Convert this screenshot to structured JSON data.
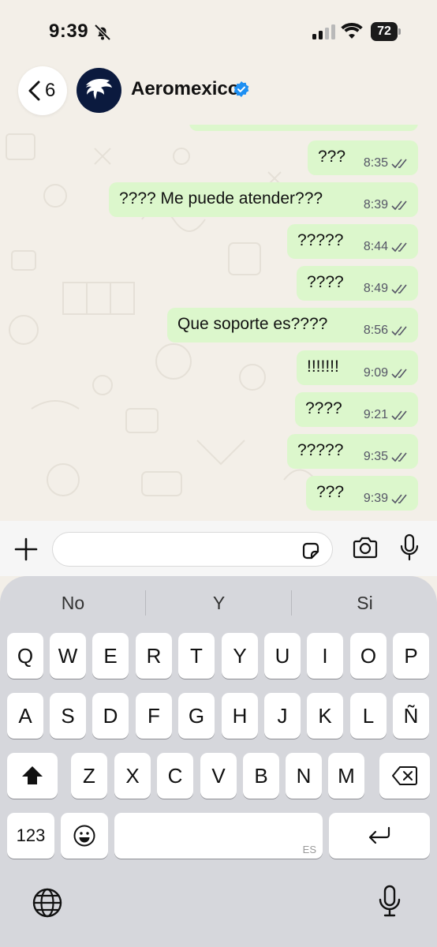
{
  "status_bar": {
    "time": "9:39",
    "battery": "72"
  },
  "header": {
    "back_count": "6",
    "contact_name": "Aeromexico"
  },
  "messages": [
    {
      "text": "???",
      "time": "8:35"
    },
    {
      "text": "???? Me puede atender???",
      "time": "8:39"
    },
    {
      "text": "?????",
      "time": "8:44"
    },
    {
      "text": "????",
      "time": "8:49"
    },
    {
      "text": "Que soporte es????",
      "time": "8:56"
    },
    {
      "text": "!!!!!!!",
      "time": "9:09"
    },
    {
      "text": "????",
      "time": "9:21"
    },
    {
      "text": "?????",
      "time": "9:35"
    },
    {
      "text": "???",
      "time": "9:39"
    }
  ],
  "input": {
    "placeholder": ""
  },
  "keyboard": {
    "suggestions": [
      "No",
      "Y",
      "Si"
    ],
    "row1": [
      "Q",
      "W",
      "E",
      "R",
      "T",
      "Y",
      "U",
      "I",
      "O",
      "P"
    ],
    "row2": [
      "A",
      "S",
      "D",
      "F",
      "G",
      "H",
      "J",
      "K",
      "L",
      "Ñ"
    ],
    "row3": [
      "Z",
      "X",
      "C",
      "V",
      "B",
      "N",
      "M"
    ],
    "numbers_key": "123",
    "space_lang": "ES"
  },
  "colors": {
    "bubble_out": "#dcf7cc",
    "verified": "#1d8ff2",
    "keyboard_bg": "#d6d7dc"
  },
  "icons": [
    "bell-slash-icon",
    "signal-icon",
    "wifi-icon",
    "chevron-left-icon",
    "verified-icon",
    "double-check-icon",
    "plus-icon",
    "sticker-icon",
    "camera-icon",
    "mic-icon",
    "shift-icon",
    "backspace-icon",
    "emoji-icon",
    "return-icon",
    "globe-icon"
  ]
}
